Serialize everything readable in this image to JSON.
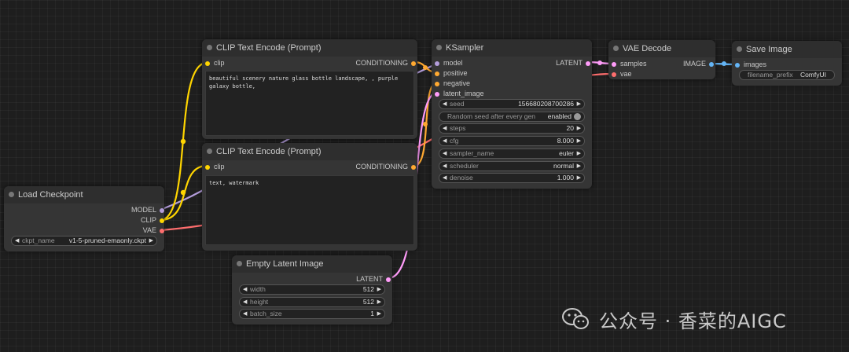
{
  "colors": {
    "model": "#b39ddb",
    "clip": "#ffd500",
    "vae": "#ff6e6e",
    "conditioning": "#ffa931",
    "latent": "#ff9cf9",
    "image": "#64b5f6",
    "background": "#1e1e1e",
    "node_body": "#353535",
    "node_title": "#2e2e2e"
  },
  "nodes": {
    "clip_pos": {
      "title": "CLIP Text Encode (Prompt)",
      "input_clip": "clip",
      "output": "CONDITIONING",
      "text": "beautiful scenery nature glass bottle landscape, , purple galaxy bottle,"
    },
    "clip_neg": {
      "title": "CLIP Text Encode (Prompt)",
      "input_clip": "clip",
      "output": "CONDITIONING",
      "text": "text, watermark"
    },
    "ksampler": {
      "title": "KSampler",
      "inputs": [
        "model",
        "positive",
        "negative",
        "latent_image"
      ],
      "output": "LATENT",
      "widgets": {
        "seed": {
          "name": "seed",
          "value": "156680208700286"
        },
        "random_seed": {
          "name": "Random seed after every gen",
          "value": "enabled"
        },
        "steps": {
          "name": "steps",
          "value": "20"
        },
        "cfg": {
          "name": "cfg",
          "value": "8.000"
        },
        "sampler_name": {
          "name": "sampler_name",
          "value": "euler"
        },
        "scheduler": {
          "name": "scheduler",
          "value": "normal"
        },
        "denoise": {
          "name": "denoise",
          "value": "1.000"
        }
      }
    },
    "vae_decode": {
      "title": "VAE Decode",
      "input_samples": "samples",
      "input_vae": "vae",
      "output": "IMAGE"
    },
    "save_image": {
      "title": "Save Image",
      "input_images": "images",
      "filename_prefix": {
        "name": "filename_prefix",
        "value": "ComfyUI"
      }
    },
    "load_checkpoint": {
      "title": "Load Checkpoint",
      "outputs": [
        "MODEL",
        "CLIP",
        "VAE"
      ],
      "ckpt_name": {
        "name": "ckpt_name",
        "value": "v1-5-pruned-emaonly.ckpt"
      }
    },
    "empty_latent": {
      "title": "Empty Latent Image",
      "output": "LATENT",
      "widgets": {
        "width": {
          "name": "width",
          "value": "512"
        },
        "height": {
          "name": "height",
          "value": "512"
        },
        "batch_size": {
          "name": "batch_size",
          "value": "1"
        }
      }
    }
  },
  "watermark": {
    "text": "公众号 · 香菜的AIGC",
    "icon": "wechat-icon"
  }
}
